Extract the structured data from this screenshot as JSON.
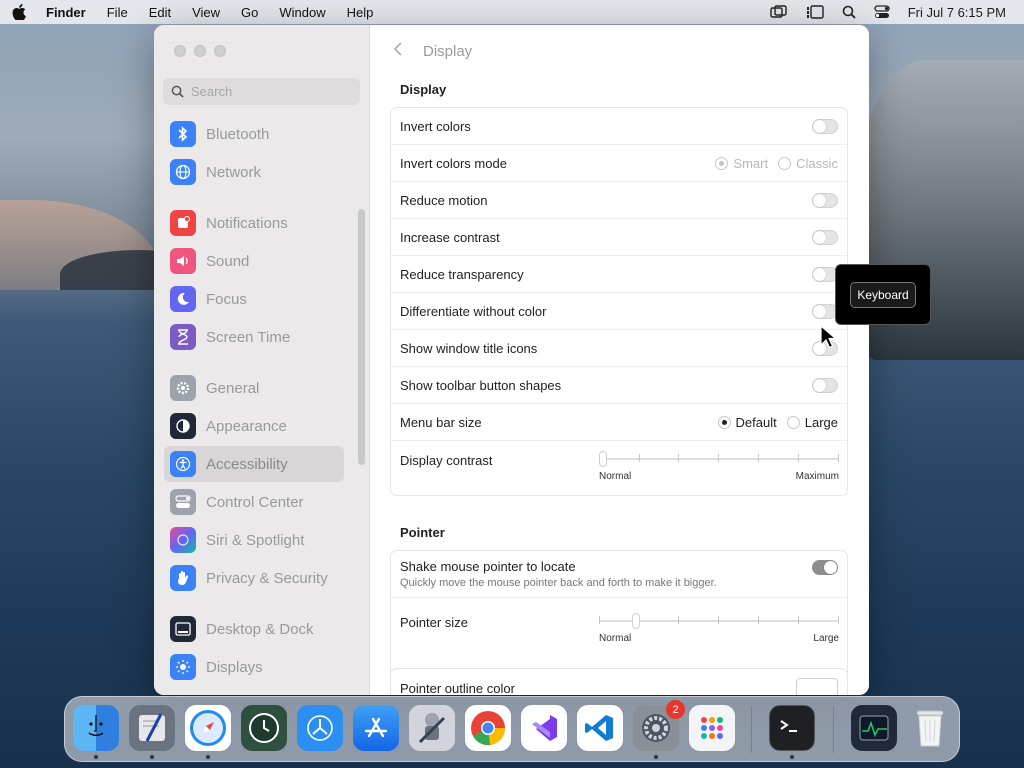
{
  "menubar": {
    "app_name": "Finder",
    "items": [
      "File",
      "Edit",
      "View",
      "Go",
      "Window",
      "Help"
    ],
    "datetime": "Fri Jul 7  6:15 PM"
  },
  "sidebar": {
    "search_placeholder": "Search",
    "items": [
      {
        "label": "Bluetooth",
        "icon": "bluetooth-icon",
        "color": "#3b82f6"
      },
      {
        "label": "Network",
        "icon": "globe-icon",
        "color": "#3b82f6"
      },
      {
        "label": "Notifications",
        "icon": "bell-icon",
        "color": "#ef4444"
      },
      {
        "label": "Sound",
        "icon": "speaker-icon",
        "color": "#ef4477"
      },
      {
        "label": "Focus",
        "icon": "moon-icon",
        "color": "#6366f1"
      },
      {
        "label": "Screen Time",
        "icon": "hourglass-icon",
        "color": "#7c5cc4"
      },
      {
        "label": "General",
        "icon": "gear-icon",
        "color": "#9ca3af"
      },
      {
        "label": "Appearance",
        "icon": "appearance-icon",
        "color": "#1f2937"
      },
      {
        "label": "Accessibility",
        "icon": "accessibility-icon",
        "color": "#3b82f6"
      },
      {
        "label": "Control Center",
        "icon": "toggles-icon",
        "color": "#9ca3af"
      },
      {
        "label": "Siri & Spotlight",
        "icon": "siri-icon",
        "color": "#a855f7"
      },
      {
        "label": "Privacy & Security",
        "icon": "hand-icon",
        "color": "#3b82f6"
      },
      {
        "label": "Desktop & Dock",
        "icon": "dock-icon",
        "color": "#1f2937"
      },
      {
        "label": "Displays",
        "icon": "sun-icon",
        "color": "#3b82f6"
      }
    ],
    "active": "Accessibility"
  },
  "main": {
    "title": "Display",
    "display_section": {
      "heading": "Display",
      "invert_colors": {
        "label": "Invert colors",
        "on": false
      },
      "invert_colors_mode": {
        "label": "Invert colors mode",
        "options": [
          "Smart",
          "Classic"
        ],
        "selected": "Smart"
      },
      "reduce_motion": {
        "label": "Reduce motion",
        "on": false
      },
      "increase_contrast": {
        "label": "Increase contrast",
        "on": false
      },
      "reduce_transparency": {
        "label": "Reduce transparency",
        "on": false
      },
      "differentiate_without_color": {
        "label": "Differentiate without color",
        "on": false
      },
      "show_window_title_icons": {
        "label": "Show window title icons",
        "on": false
      },
      "show_toolbar_button_shapes": {
        "label": "Show toolbar button shapes",
        "on": false
      },
      "menu_bar_size": {
        "label": "Menu bar size",
        "options": [
          "Default",
          "Large"
        ],
        "selected": "Default"
      },
      "display_contrast": {
        "label": "Display contrast",
        "min_label": "Normal",
        "max_label": "Maximum",
        "value": 0
      }
    },
    "pointer_section": {
      "heading": "Pointer",
      "shake_to_locate": {
        "label": "Shake mouse pointer to locate",
        "description": "Quickly move the mouse pointer back and forth to make it bigger.",
        "on": true
      },
      "pointer_size": {
        "label": "Pointer size",
        "min_label": "Normal",
        "max_label": "Large",
        "value": 0.15
      },
      "pointer_outline_color": {
        "label": "Pointer outline color"
      }
    }
  },
  "tooltip": {
    "key": "Keyboard"
  },
  "dock": {
    "apps": [
      {
        "name": "finder-icon",
        "running": true
      },
      {
        "name": "script-editor-icon",
        "running": true
      },
      {
        "name": "safari-icon",
        "running": true
      },
      {
        "name": "time-machine-icon",
        "running": false
      },
      {
        "name": "testflight-icon",
        "running": false
      },
      {
        "name": "app-store-icon",
        "running": false
      },
      {
        "name": "automator-icon",
        "running": false
      },
      {
        "name": "chrome-icon",
        "running": false
      },
      {
        "name": "visual-studio-icon",
        "running": false
      },
      {
        "name": "vscode-icon",
        "running": false
      },
      {
        "name": "system-settings-icon",
        "running": true,
        "badge": "2"
      },
      {
        "name": "launchpad-icon",
        "running": false
      }
    ],
    "recent": [
      {
        "name": "terminal-icon",
        "running": true
      },
      {
        "name": "activity-monitor-icon",
        "running": false
      },
      {
        "name": "trash-icon",
        "running": false
      }
    ]
  }
}
